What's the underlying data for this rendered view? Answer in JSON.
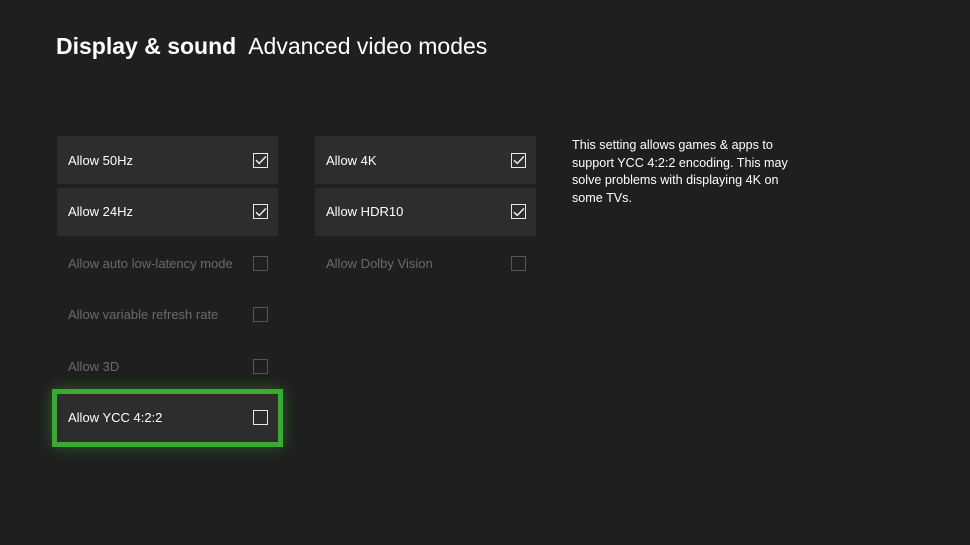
{
  "header": {
    "section": "Display & sound",
    "subpage": "Advanced video modes"
  },
  "left_options": [
    {
      "label": "Allow 50Hz",
      "checked": true,
      "enabled": true
    },
    {
      "label": "Allow 24Hz",
      "checked": true,
      "enabled": true
    },
    {
      "label": "Allow auto low-latency mode",
      "checked": false,
      "enabled": false
    },
    {
      "label": "Allow variable refresh rate",
      "checked": false,
      "enabled": false
    },
    {
      "label": "Allow 3D",
      "checked": false,
      "enabled": false
    },
    {
      "label": "Allow YCC 4:2:2",
      "checked": false,
      "enabled": true,
      "focused": true
    }
  ],
  "right_options": [
    {
      "label": "Allow 4K",
      "checked": true,
      "enabled": true
    },
    {
      "label": "Allow HDR10",
      "checked": true,
      "enabled": true
    },
    {
      "label": "Allow Dolby Vision",
      "checked": false,
      "enabled": false
    }
  ],
  "description": "This setting allows games & apps to support YCC 4:2:2 encoding. This may solve problems with displaying 4K on some TVs.",
  "colors": {
    "background": "#1f1f1f",
    "tile": "#2d2d2d",
    "focus": "#3ba934",
    "disabled_text": "#6a6a6a"
  },
  "icons": {
    "checked": "checkmark-icon",
    "unchecked": "empty-checkbox-icon"
  }
}
